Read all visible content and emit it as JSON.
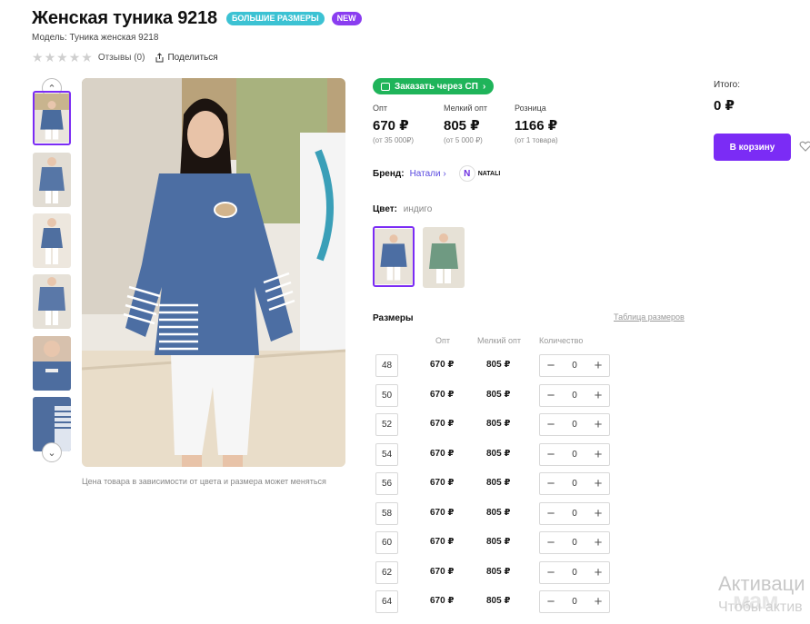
{
  "product": {
    "title": "Женская туника 9218",
    "badges": [
      "БОЛЬШИЕ РАЗМЕРЫ",
      "NEW"
    ],
    "model": "Модель: Туника женская 9218",
    "reviews": "Отзывы (0)",
    "share": "Поделиться",
    "rating_stars": 0,
    "photo_note": "Цена товара в зависимости от цвета и размера может меняться"
  },
  "order_sp": {
    "label": "Заказать через СП"
  },
  "prices": [
    {
      "label": "Опт",
      "value": "670 ₽",
      "sub": "(от 35 000₽)"
    },
    {
      "label": "Мелкий опт",
      "value": "805 ₽",
      "sub": "(от 5 000 ₽)"
    },
    {
      "label": "Розница",
      "value": "1166 ₽",
      "sub": "(от 1 товара)"
    }
  ],
  "brand": {
    "label": "Бренд:",
    "name": "Натали",
    "logo_text": "NATALI"
  },
  "color": {
    "label": "Цвет:",
    "value": "индиго"
  },
  "sizes": {
    "title": "Размеры",
    "table_link": "Таблица размеров",
    "headers": [
      "Опт",
      "Мелкий опт",
      "Количество"
    ],
    "rows": [
      {
        "size": "48",
        "opt": "670 ₽",
        "mopt": "805 ₽",
        "qty": "0"
      },
      {
        "size": "50",
        "opt": "670 ₽",
        "mopt": "805 ₽",
        "qty": "0"
      },
      {
        "size": "52",
        "opt": "670 ₽",
        "mopt": "805 ₽",
        "qty": "0"
      },
      {
        "size": "54",
        "opt": "670 ₽",
        "mopt": "805 ₽",
        "qty": "0"
      },
      {
        "size": "56",
        "opt": "670 ₽",
        "mopt": "805 ₽",
        "qty": "0"
      },
      {
        "size": "58",
        "opt": "670 ₽",
        "mopt": "805 ₽",
        "qty": "0"
      },
      {
        "size": "60",
        "opt": "670 ₽",
        "mopt": "805 ₽",
        "qty": "0"
      },
      {
        "size": "62",
        "opt": "670 ₽",
        "mopt": "805 ₽",
        "qty": "0"
      },
      {
        "size": "64",
        "opt": "670 ₽",
        "mopt": "805 ₽",
        "qty": "0"
      }
    ]
  },
  "cart": {
    "total_label": "Итого:",
    "total_value": "0 ₽",
    "button": "В корзину"
  },
  "watermark": {
    "line1": "Активаци",
    "line2": "Чтобы актив",
    "logo": "мам"
  },
  "colors": {
    "accent": "#7b2cf5",
    "green": "#1fb45a",
    "badge_teal": "#3cc2d3"
  }
}
